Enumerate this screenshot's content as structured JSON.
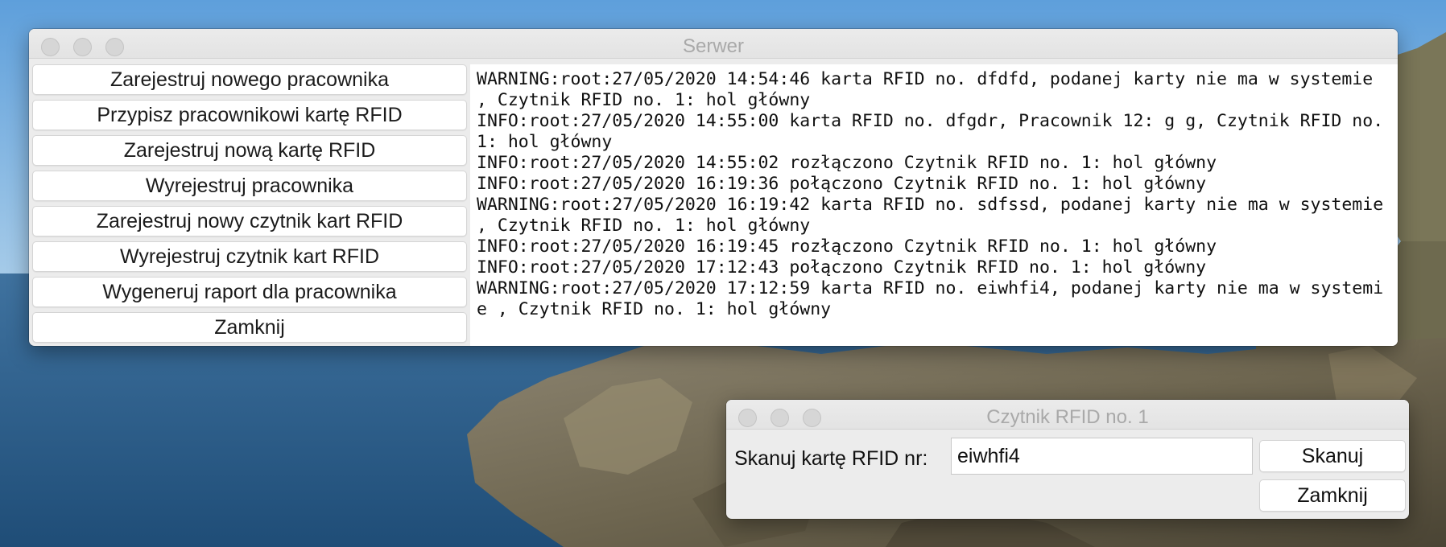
{
  "server_window": {
    "title": "Serwer",
    "buttons": [
      {
        "label": "Zarejestruj nowego pracownika"
      },
      {
        "label": "Przypisz pracownikowi kartę RFID"
      },
      {
        "label": "Zarejestruj nową kartę RFID"
      },
      {
        "label": "Wyrejestruj pracownika"
      },
      {
        "label": "Zarejestruj nowy czytnik kart RFID"
      },
      {
        "label": "Wyrejestruj czytnik kart RFID"
      },
      {
        "label": "Wygeneruj raport dla pracownika"
      },
      {
        "label": "Zamknij"
      }
    ],
    "log": [
      "WARNING:root:27/05/2020 14:54:46 karta RFID no. dfdfd, podanej karty nie ma w systemie , Czytnik RFID no. 1: hol główny",
      "INFO:root:27/05/2020 14:55:00 karta RFID no. dfgdr, Pracownik 12: g g, Czytnik RFID no. 1: hol główny",
      "INFO:root:27/05/2020 14:55:02 rozłączono Czytnik RFID no. 1: hol główny",
      "INFO:root:27/05/2020 16:19:36 połączono Czytnik RFID no. 1: hol główny",
      "WARNING:root:27/05/2020 16:19:42 karta RFID no. sdfssd, podanej karty nie ma w systemie , Czytnik RFID no. 1: hol główny",
      "INFO:root:27/05/2020 16:19:45 rozłączono Czytnik RFID no. 1: hol główny",
      "INFO:root:27/05/2020 17:12:43 połączono Czytnik RFID no. 1: hol główny",
      "WARNING:root:27/05/2020 17:12:59 karta RFID no. eiwhfi4, podanej karty nie ma w systemie , Czytnik RFID no. 1: hol główny"
    ]
  },
  "reader_window": {
    "title": "Czytnik RFID no. 1",
    "scan_label": "Skanuj kartę RFID nr:",
    "card_input_value": "eiwhfi4",
    "scan_button": "Skanuj",
    "close_button": "Zamknij"
  }
}
